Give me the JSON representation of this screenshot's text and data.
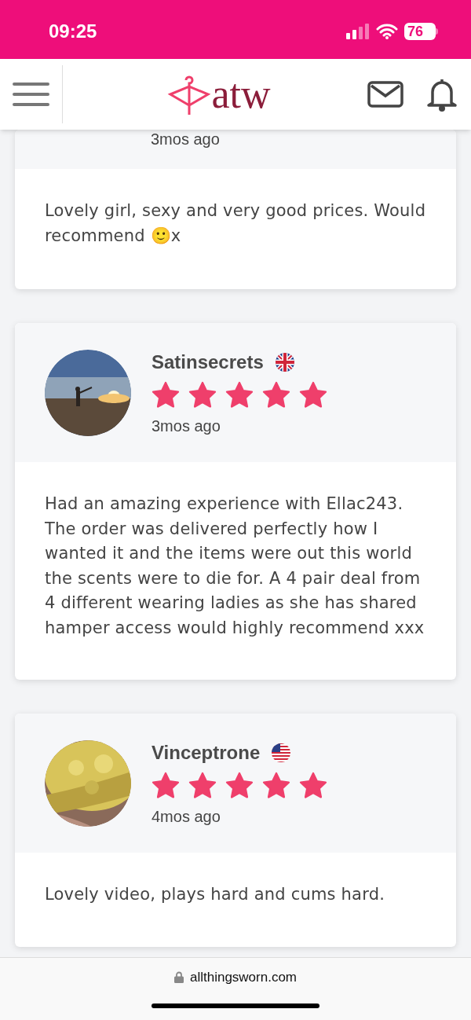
{
  "status_bar": {
    "time": "09:25",
    "battery": "76"
  },
  "header": {
    "logo": "atw"
  },
  "reviews": [
    {
      "time": "3mos ago",
      "text": "Lovely girl, sexy and very good prices. Would recommend 🙂x",
      "partial": true
    },
    {
      "name": "Satinsecrets",
      "flag": {
        "kind": "uk"
      },
      "stars": 5,
      "time": "3mos ago",
      "text": "Had an amazing experience with Ellac243. The order was delivered perfectly how I wanted it and the items were out this world the scents were to die for. A 4 pair deal from 4 different wearing ladies as she has shared hamper access would highly recommend xxx"
    },
    {
      "name": "Vinceptrone",
      "flag": {
        "kind": "us"
      },
      "stars": 5,
      "time": "4mos ago",
      "text": "Lovely video, plays hard and cums hard."
    }
  ],
  "url_bar": {
    "url": "allthingsworn.com"
  }
}
